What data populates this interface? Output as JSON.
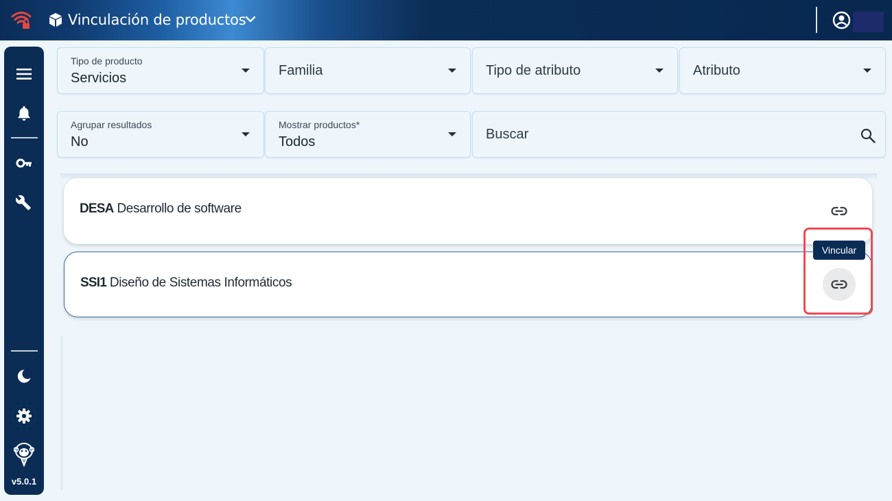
{
  "app": {
    "title": "Vinculación de productos",
    "version": "v5.0.1"
  },
  "icons": {
    "wifi": "wifi-locked-icon",
    "app": "cube-icon",
    "title_chevron": "chevron-down-icon",
    "account": "account-circle-icon",
    "menu": "menu-icon",
    "notifications": "bell-icon",
    "key": "key-icon",
    "tools": "wrench-icon",
    "theme": "moon-icon",
    "settings": "gear-icon",
    "logo": "monkey-logo-icon",
    "search": "search-icon",
    "link": "link-icon"
  },
  "filters": {
    "tipo_producto": {
      "label": "Tipo de producto",
      "value": "Servicios"
    },
    "familia": {
      "placeholder": "Familia"
    },
    "tipo_atributo": {
      "placeholder": "Tipo de atributo"
    },
    "atributo": {
      "placeholder": "Atributo"
    },
    "agrupar": {
      "label": "Agrupar resultados",
      "value": "No"
    },
    "mostrar": {
      "label": "Mostrar productos*",
      "value": "Todos"
    },
    "buscar": {
      "placeholder": "Buscar"
    }
  },
  "results": [
    {
      "code": "DESA",
      "name": "Desarrollo de software"
    },
    {
      "code": "SSI1",
      "name": "Diseño de Sistemas Informáticos"
    }
  ],
  "tooltip": {
    "text": "Vincular"
  },
  "colors": {
    "topbar": "#0b2c55",
    "sidebar": "#0b2c55",
    "background": "#eef6fc",
    "field_border": "#bfe0f3",
    "highlight": "#ef4a52",
    "wifi_alert": "#e8463f"
  }
}
